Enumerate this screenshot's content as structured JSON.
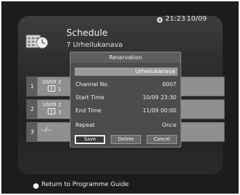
{
  "header": {
    "time": "21:23",
    "date": "10/09"
  },
  "title": "Schedule",
  "channel_line": "7  Urheilukanava",
  "rows": [
    {
      "index": "1",
      "date": "10/09",
      "extra_top": "2",
      "extra_bottom": "1"
    },
    {
      "index": "2",
      "date": "10/09",
      "extra_top": "2",
      "extra_bottom": "3"
    },
    {
      "index": "3",
      "placeholder": "--/--"
    }
  ],
  "dialog": {
    "title": "Reservation",
    "channel_name": "Urheilukanava",
    "fields": [
      {
        "label": "Channel No.",
        "value": "0007"
      },
      {
        "label": "Start Time",
        "value": "10/09  23:30"
      },
      {
        "label": "End Time",
        "value": "11/09  00:00"
      },
      {
        "label": "Repeat",
        "value": "Once"
      }
    ],
    "buttons": [
      "Save",
      "Delete",
      "Cancel"
    ],
    "selected_button": "Save"
  },
  "footer": {
    "hint": "Return to Programme Guide"
  }
}
